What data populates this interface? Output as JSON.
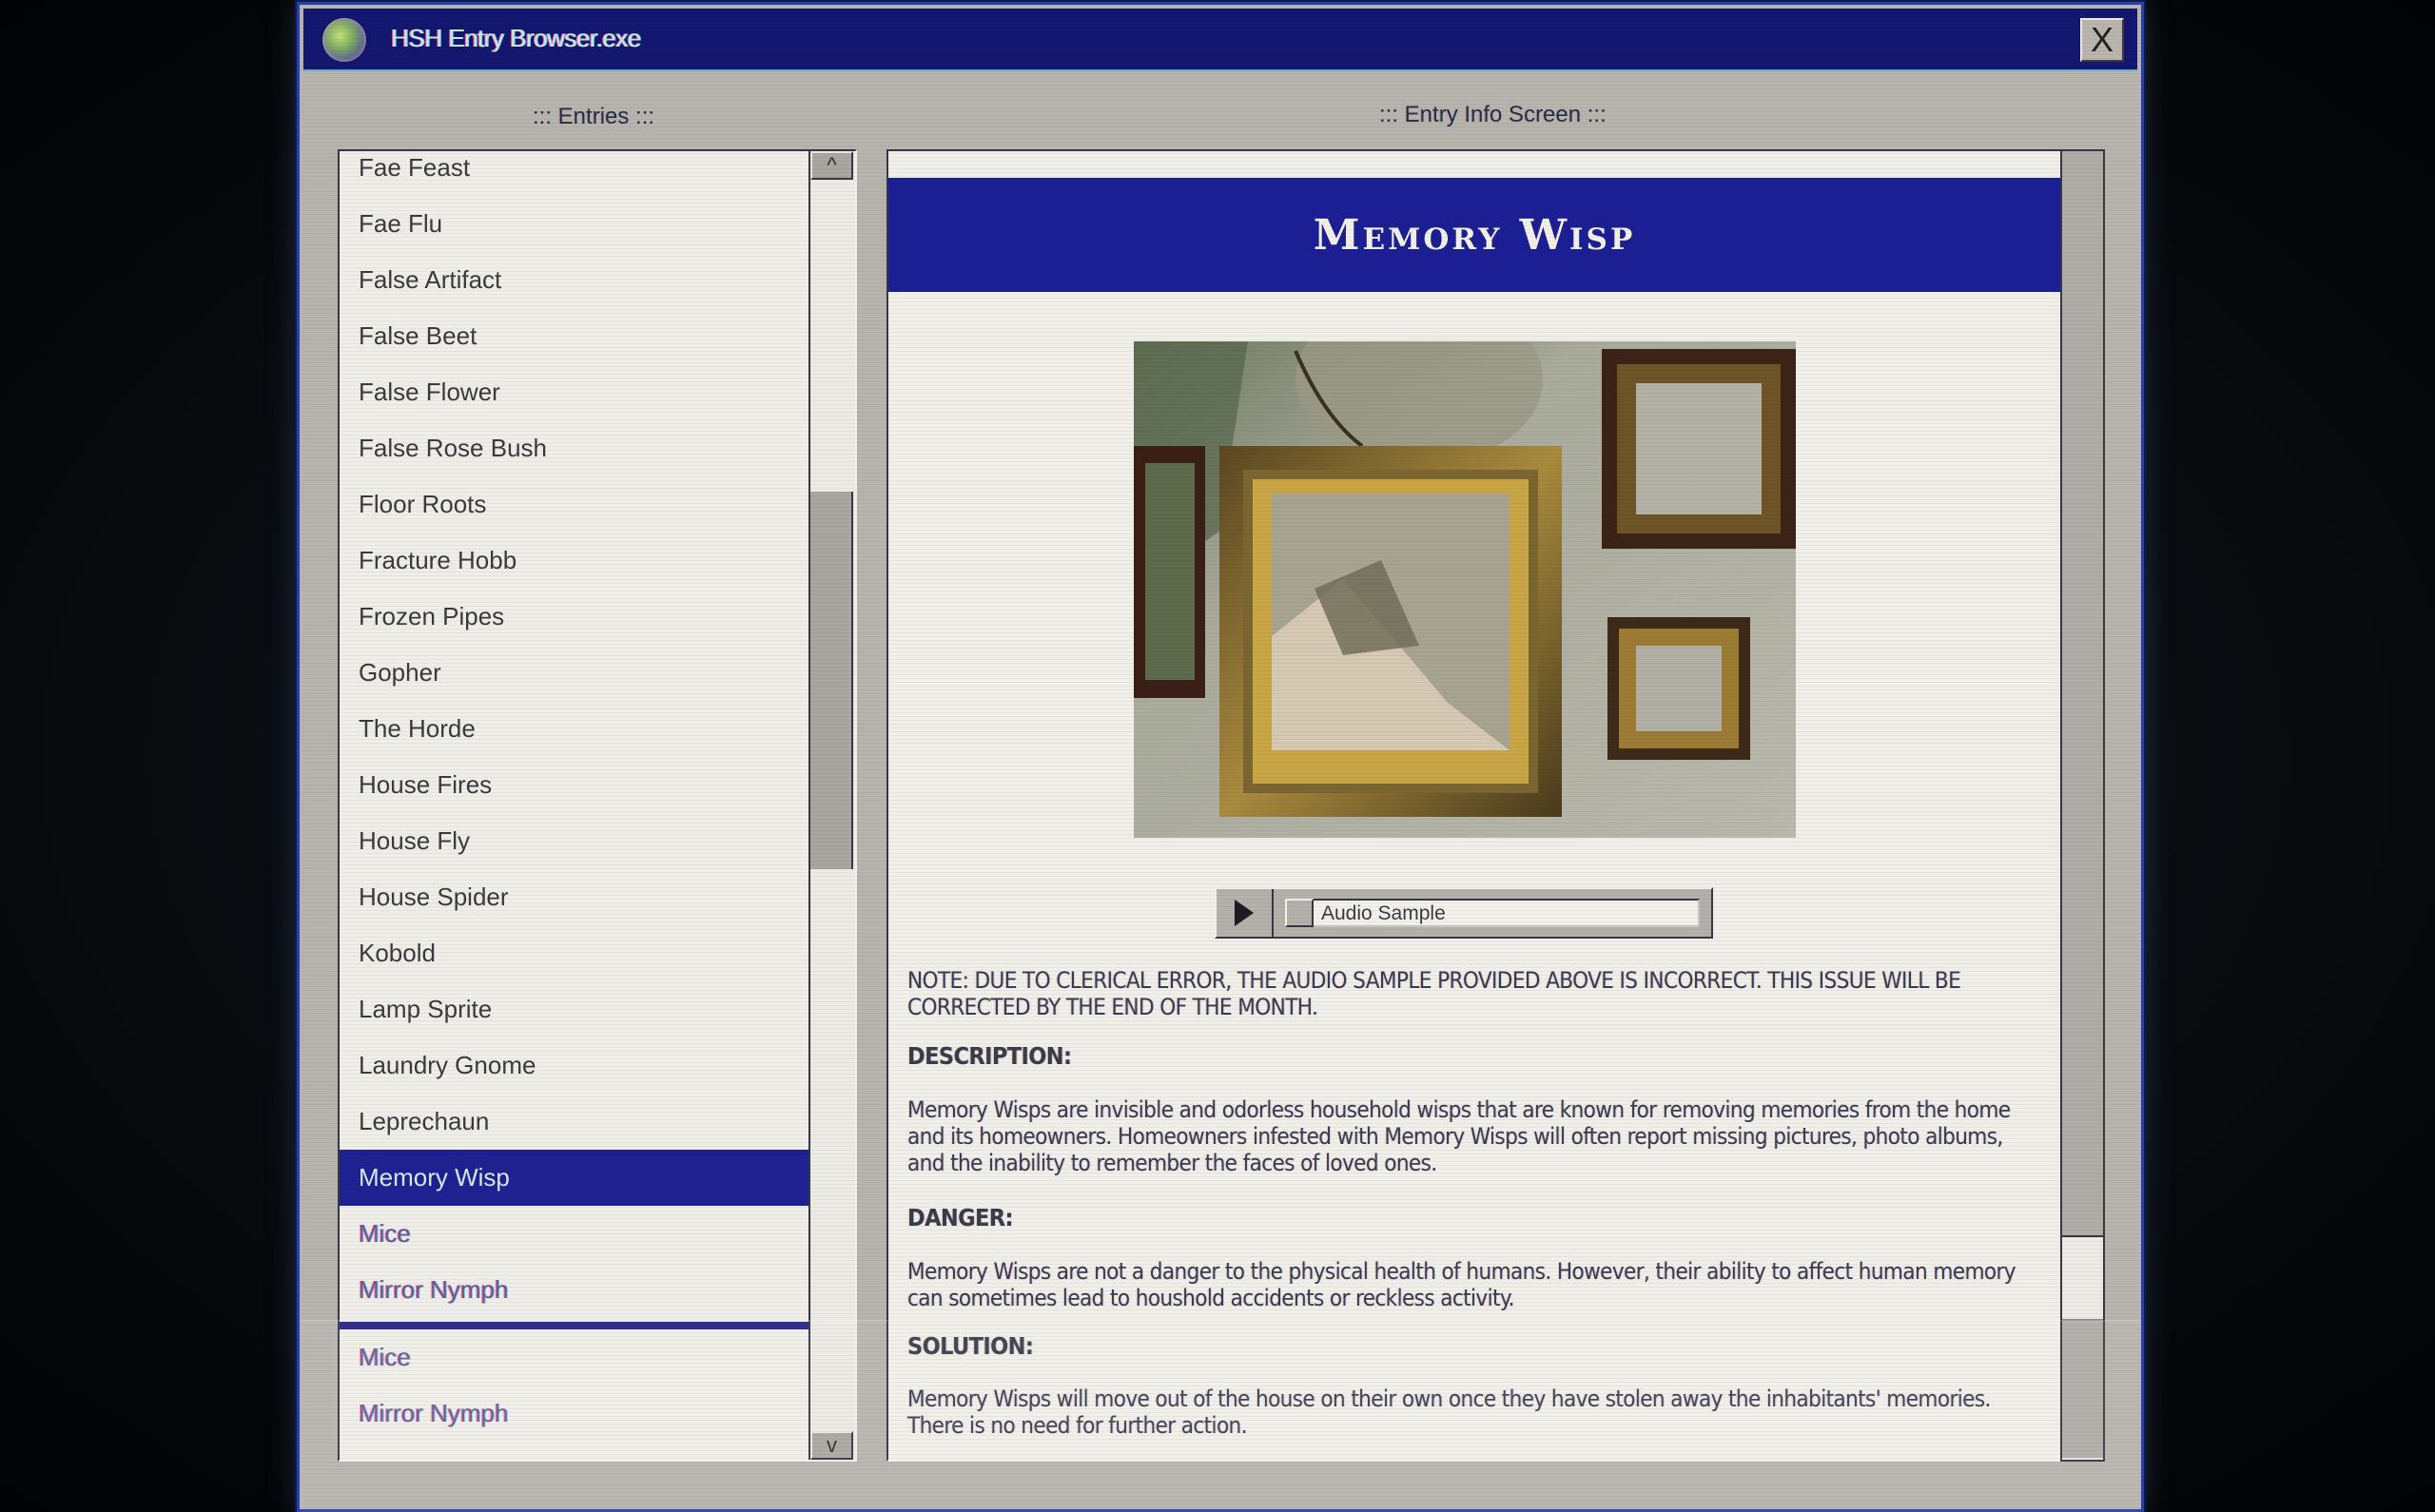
{
  "window": {
    "title": "HSH Entry Browser.exe",
    "app_icon": "globe-icon",
    "close_label": "X"
  },
  "entries_panel": {
    "label": "::: Entries :::",
    "scroll_up_label": "^",
    "scroll_down_label": "v",
    "items": [
      "Fae Feast",
      "Fae Flu",
      "False Artifact",
      "False Beet",
      "False Flower",
      "False Rose Bush",
      "Floor Roots",
      "Fracture Hobb",
      "Frozen Pipes",
      "Gopher",
      "The Horde",
      "House Fires",
      "House Fly",
      "House Spider",
      "Kobold",
      "Lamp Sprite",
      "Laundry Gnome",
      "Leprechaun",
      "Memory Wisp",
      "Mice",
      "Mirror Nymph"
    ],
    "selected": "Memory Wisp",
    "glitch_repeat_items": [
      "Mice",
      "Mirror Nymph"
    ]
  },
  "info_panel": {
    "label": "::: Entry Info Screen :::",
    "title": "Memory Wisp",
    "image_alt": "Empty ornate gilded picture frames hanging on a cracked plaster wall",
    "audio": {
      "play_icon": "play-icon",
      "label": "Audio Sample"
    },
    "note": "NOTE: DUE TO CLERICAL ERROR, THE AUDIO SAMPLE PROVIDED ABOVE IS INCORRECT. THIS ISSUE WILL BE CORRECTED BY THE END OF THE MONTH.",
    "description_heading": "DESCRIPTION:",
    "description": "Memory Wisps are invisible and odorless household wisps that are known for removing memories from the home and its homeowners. Homeowners infested with Memory Wisps will often report missing pictures, photo albums, and the inability to remember the faces of loved ones.",
    "danger_heading": "DANGER:",
    "danger": "Memory Wisps are not a danger to the physical health of humans. However, their ability to affect human memory can sometimes lead to houshold accidents or reckless activity.",
    "solution_heading": "SOLUTION:",
    "solution": "Memory Wisps will move out of the house on their own once they have stolen away the inhabitants' memories. There is no need for further action."
  },
  "colors": {
    "titlebar": "#13176f",
    "header_band": "#1c1f93",
    "selection": "#1e2191",
    "window_bg": "#b7b4ae",
    "panel_bg": "#f0eee8"
  }
}
